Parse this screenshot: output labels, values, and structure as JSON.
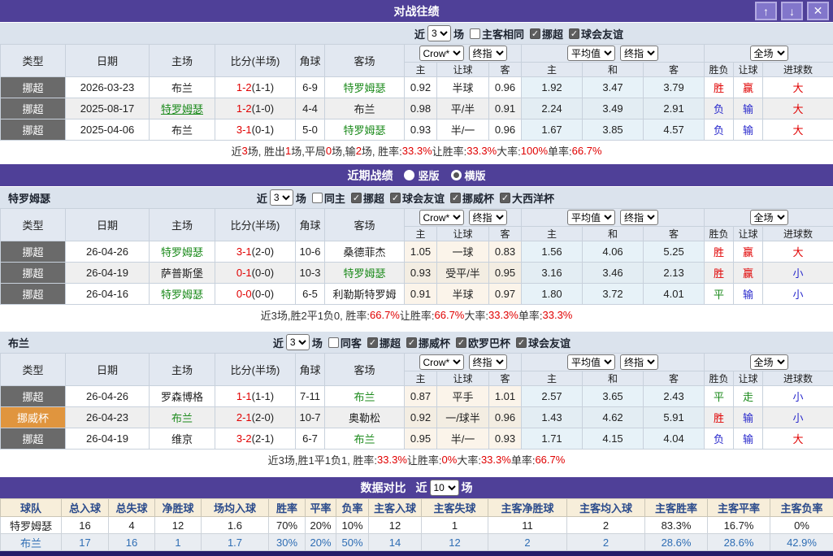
{
  "glyphs": {
    "check": "✓",
    "up": "↑",
    "down": "↓",
    "close": "✕"
  },
  "colors": {
    "purple": "#4F4098",
    "accent_red": "#E00000",
    "accent_blue": "#2929CC",
    "accent_green": "#1B8A1B",
    "league_dark": "#6A6A6A",
    "league_orange": "#E0953E",
    "avg_col_bg": "#E7F2F8",
    "odds_col_bg": "#FBF4EA",
    "compare_header_bg": "#F7EEDA",
    "compare_header_text": "#2B4B8C",
    "away_row_text": "#2E6DB4"
  },
  "bet_header": {
    "type": "类型",
    "date": "日期",
    "home": "主场",
    "score": "比分(半场)",
    "corner": "角球",
    "away": "客场",
    "odds_home": "主",
    "odds_handicap": "让球",
    "odds_away": "客",
    "avg_home": "主",
    "avg_draw": "和",
    "avg_away": "客",
    "result": "胜负",
    "handicap_result": "让球",
    "goals": "进球数",
    "company_select": "Crow*",
    "final_select": "终指",
    "avg_select": "平均值",
    "final_select2": "终指",
    "scope_select": "全场"
  },
  "h2h": {
    "title": "对战往绩",
    "filter": {
      "near": "近",
      "count": "3",
      "unit": "场",
      "options": [
        {
          "label": "主客相同",
          "checked": false
        },
        {
          "label": "挪超",
          "checked": true
        },
        {
          "label": "球会友谊",
          "checked": true
        }
      ]
    },
    "rows": [
      {
        "league": "挪超",
        "date": "2026-03-23",
        "home": "布兰",
        "score": "1-2",
        "half": "(1-1)",
        "corner": "6-9",
        "away": "特罗姆瑟",
        "o1": "0.92",
        "hc": "半球",
        "o2": "0.96",
        "a1": "1.92",
        "a2": "3.47",
        "a3": "3.79",
        "r1": "胜",
        "r2": "赢",
        "r3": "大"
      },
      {
        "league": "挪超",
        "date": "2025-08-17",
        "home": "特罗姆瑟",
        "score": "1-2",
        "half": "(1-0)",
        "corner": "4-4",
        "away": "布兰",
        "o1": "0.98",
        "hc": "平/半",
        "o2": "0.91",
        "a1": "2.24",
        "a2": "3.49",
        "a3": "2.91",
        "r1": "负",
        "r2": "输",
        "r3": "大"
      },
      {
        "league": "挪超",
        "date": "2025-04-06",
        "home": "布兰",
        "score": "3-1",
        "half": "(0-1)",
        "corner": "5-0",
        "away": "特罗姆瑟",
        "o1": "0.93",
        "hc": "半/一",
        "o2": "0.96",
        "a1": "1.67",
        "a2": "3.85",
        "a3": "4.57",
        "r1": "负",
        "r2": "输",
        "r3": "大"
      }
    ],
    "summary": [
      {
        "t": "近 "
      },
      {
        "t": "3"
      },
      {
        "t": " 场, 胜出 "
      },
      {
        "t": "1"
      },
      {
        "t": " 场,平局 "
      },
      {
        "t": "0"
      },
      {
        "t": " 场,输 "
      },
      {
        "t": "2"
      },
      {
        "t": " 场, 胜率: "
      },
      {
        "t": "33.3%"
      },
      {
        "t": " 让胜率: "
      },
      {
        "t": "33.3%"
      },
      {
        "t": " 大率: "
      },
      {
        "t": "100%"
      },
      {
        "t": " 单率: "
      },
      {
        "t": "66.7%"
      }
    ]
  },
  "recent": {
    "title": "近期战绩",
    "radios": [
      {
        "label": "竖版",
        "checked": false
      },
      {
        "label": "横版",
        "checked": true
      }
    ],
    "team1": {
      "name": "特罗姆瑟",
      "filter": {
        "near": "近",
        "count": "3",
        "unit": "场",
        "options": [
          {
            "label": "同主",
            "checked": false
          },
          {
            "label": "挪超",
            "checked": true
          },
          {
            "label": "球会友谊",
            "checked": true
          },
          {
            "label": "挪威杯",
            "checked": true
          },
          {
            "label": "大西洋杯",
            "checked": true
          }
        ]
      },
      "rows": [
        {
          "league": "挪超",
          "date": "26-04-26",
          "home": "特罗姆瑟",
          "score": "3-1",
          "half": "(2-0)",
          "corner": "10-6",
          "away": "桑德菲杰",
          "o1": "1.05",
          "hc": "一球",
          "o2": "0.83",
          "a1": "1.56",
          "a2": "4.06",
          "a3": "5.25",
          "r1": "胜",
          "r2": "赢",
          "r3": "大"
        },
        {
          "league": "挪超",
          "date": "26-04-19",
          "home": "萨普斯堡",
          "score": "0-1",
          "half": "(0-0)",
          "corner": "10-3",
          "away": "特罗姆瑟",
          "o1": "0.93",
          "hc": "受平/半",
          "o2": "0.95",
          "a1": "3.16",
          "a2": "3.46",
          "a3": "2.13",
          "r1": "胜",
          "r2": "赢",
          "r3": "小"
        },
        {
          "league": "挪超",
          "date": "26-04-16",
          "home": "特罗姆瑟",
          "score": "0-0",
          "half": "(0-0)",
          "corner": "6-5",
          "away": "利勒斯特罗姆",
          "o1": "0.91",
          "hc": "半球",
          "o2": "0.97",
          "a1": "1.80",
          "a2": "3.72",
          "a3": "4.01",
          "r1": "平",
          "r2": "输",
          "r3": "小"
        }
      ],
      "summary": [
        {
          "t": "近3场,胜2平1负0, 胜率:"
        },
        {
          "t": "66.7%"
        },
        {
          "t": " 让胜率:"
        },
        {
          "t": "66.7%"
        },
        {
          "t": " 大率:"
        },
        {
          "t": "33.3%"
        },
        {
          "t": " 单率:"
        },
        {
          "t": "33.3%"
        }
      ]
    },
    "team2": {
      "name": "布兰",
      "filter": {
        "near": "近",
        "count": "3",
        "unit": "场",
        "options": [
          {
            "label": "同客",
            "checked": false
          },
          {
            "label": "挪超",
            "checked": true
          },
          {
            "label": "挪威杯",
            "checked": true
          },
          {
            "label": "欧罗巴杯",
            "checked": true
          },
          {
            "label": "球会友谊",
            "checked": true
          }
        ]
      },
      "rows": [
        {
          "league": "挪超",
          "date": "26-04-26",
          "home": "罗森博格",
          "score": "1-1",
          "half": "(1-1)",
          "corner": "7-11",
          "away": "布兰",
          "o1": "0.87",
          "hc": "平手",
          "o2": "1.01",
          "a1": "2.57",
          "a2": "3.65",
          "a3": "2.43",
          "r1": "平",
          "r2": "走",
          "r3": "小"
        },
        {
          "league": "挪威杯",
          "date": "26-04-23",
          "home": "布兰",
          "score": "2-1",
          "half": "(2-0)",
          "corner": "10-7",
          "away": "奥勒松",
          "o1": "0.92",
          "hc": "一/球半",
          "o2": "0.96",
          "a1": "1.43",
          "a2": "4.62",
          "a3": "5.91",
          "r1": "胜",
          "r2": "输",
          "r3": "小"
        },
        {
          "league": "挪超",
          "date": "26-04-19",
          "home": "维京",
          "score": "3-2",
          "half": "(2-1)",
          "corner": "6-7",
          "away": "布兰",
          "o1": "0.95",
          "hc": "半/一",
          "o2": "0.93",
          "a1": "1.71",
          "a2": "4.15",
          "a3": "4.04",
          "r1": "负",
          "r2": "输",
          "r3": "大"
        }
      ],
      "summary": [
        {
          "t": "近3场,胜1平1负1, 胜率:"
        },
        {
          "t": "33.3%"
        },
        {
          "t": " 让胜率:"
        },
        {
          "t": "0%"
        },
        {
          "t": " 大率:"
        },
        {
          "t": "33.3%"
        },
        {
          "t": " 单率:"
        },
        {
          "t": "66.7%"
        }
      ]
    }
  },
  "compare": {
    "title": "数据对比",
    "near": "近",
    "count": "10",
    "unit": "场",
    "headers": [
      "球队",
      "总入球",
      "总失球",
      "净胜球",
      "场均入球",
      "胜率",
      "平率",
      "负率",
      "主客入球",
      "主客失球",
      "主客净胜球",
      "主客均入球",
      "主客胜率",
      "主客平率",
      "主客负率"
    ],
    "rows": [
      {
        "team": "特罗姆瑟",
        "values": [
          "16",
          "4",
          "12",
          "1.6",
          "70%",
          "20%",
          "10%",
          "12",
          "1",
          "11",
          "2",
          "83.3%",
          "16.7%",
          "0%"
        ]
      },
      {
        "team": "布兰",
        "values": [
          "17",
          "16",
          "1",
          "1.7",
          "30%",
          "20%",
          "50%",
          "14",
          "12",
          "2",
          "2",
          "28.6%",
          "28.6%",
          "42.9%"
        ]
      }
    ]
  }
}
